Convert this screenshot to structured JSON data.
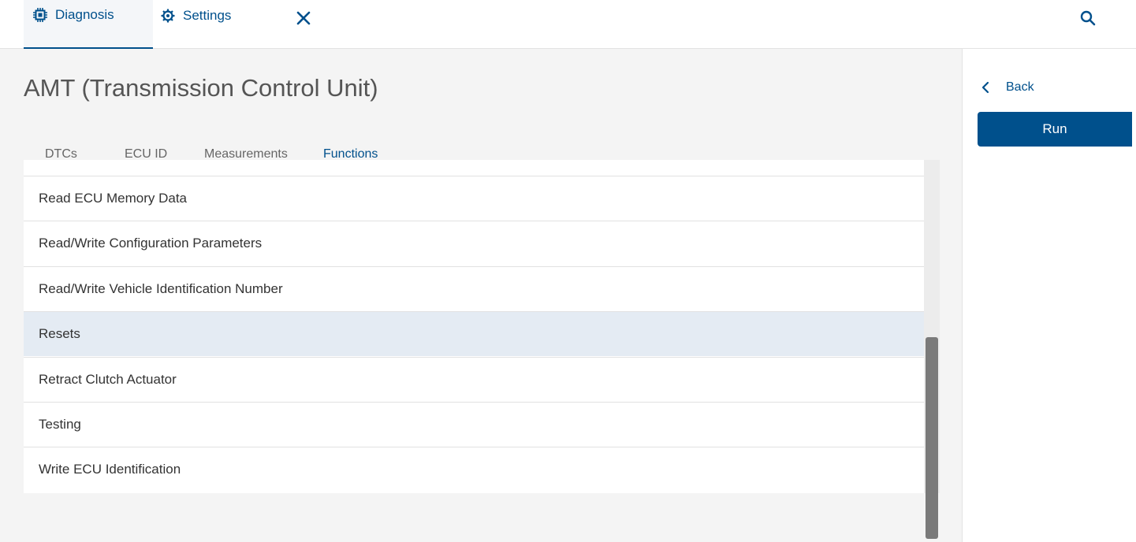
{
  "header": {
    "tabs": [
      {
        "label": "Diagnosis",
        "icon": "chip-icon",
        "active": true
      },
      {
        "label": "Settings",
        "icon": "gear-icon",
        "active": false
      }
    ],
    "close_icon": "close-icon",
    "search_icon": "search-icon"
  },
  "main": {
    "title": "AMT (Transmission Control Unit)",
    "subtabs": [
      {
        "label": "DTCs"
      },
      {
        "label": "ECU ID"
      },
      {
        "label": "Measurements"
      },
      {
        "label": "Functions",
        "active": true
      }
    ],
    "functions": [
      {
        "label": "Read ECU Memory Data"
      },
      {
        "label": "Read/Write Configuration Parameters"
      },
      {
        "label": "Read/Write Vehicle Identification Number"
      },
      {
        "label": "Resets",
        "selected": true
      },
      {
        "label": "Retract Clutch Actuator"
      },
      {
        "label": "Testing"
      },
      {
        "label": "Write ECU Identification"
      }
    ]
  },
  "sidebar": {
    "back_label": "Back",
    "run_label": "Run"
  },
  "colors": {
    "accent": "#00508c",
    "selected_row": "#e4ebf3",
    "panel_bg": "#f4f4f4"
  }
}
